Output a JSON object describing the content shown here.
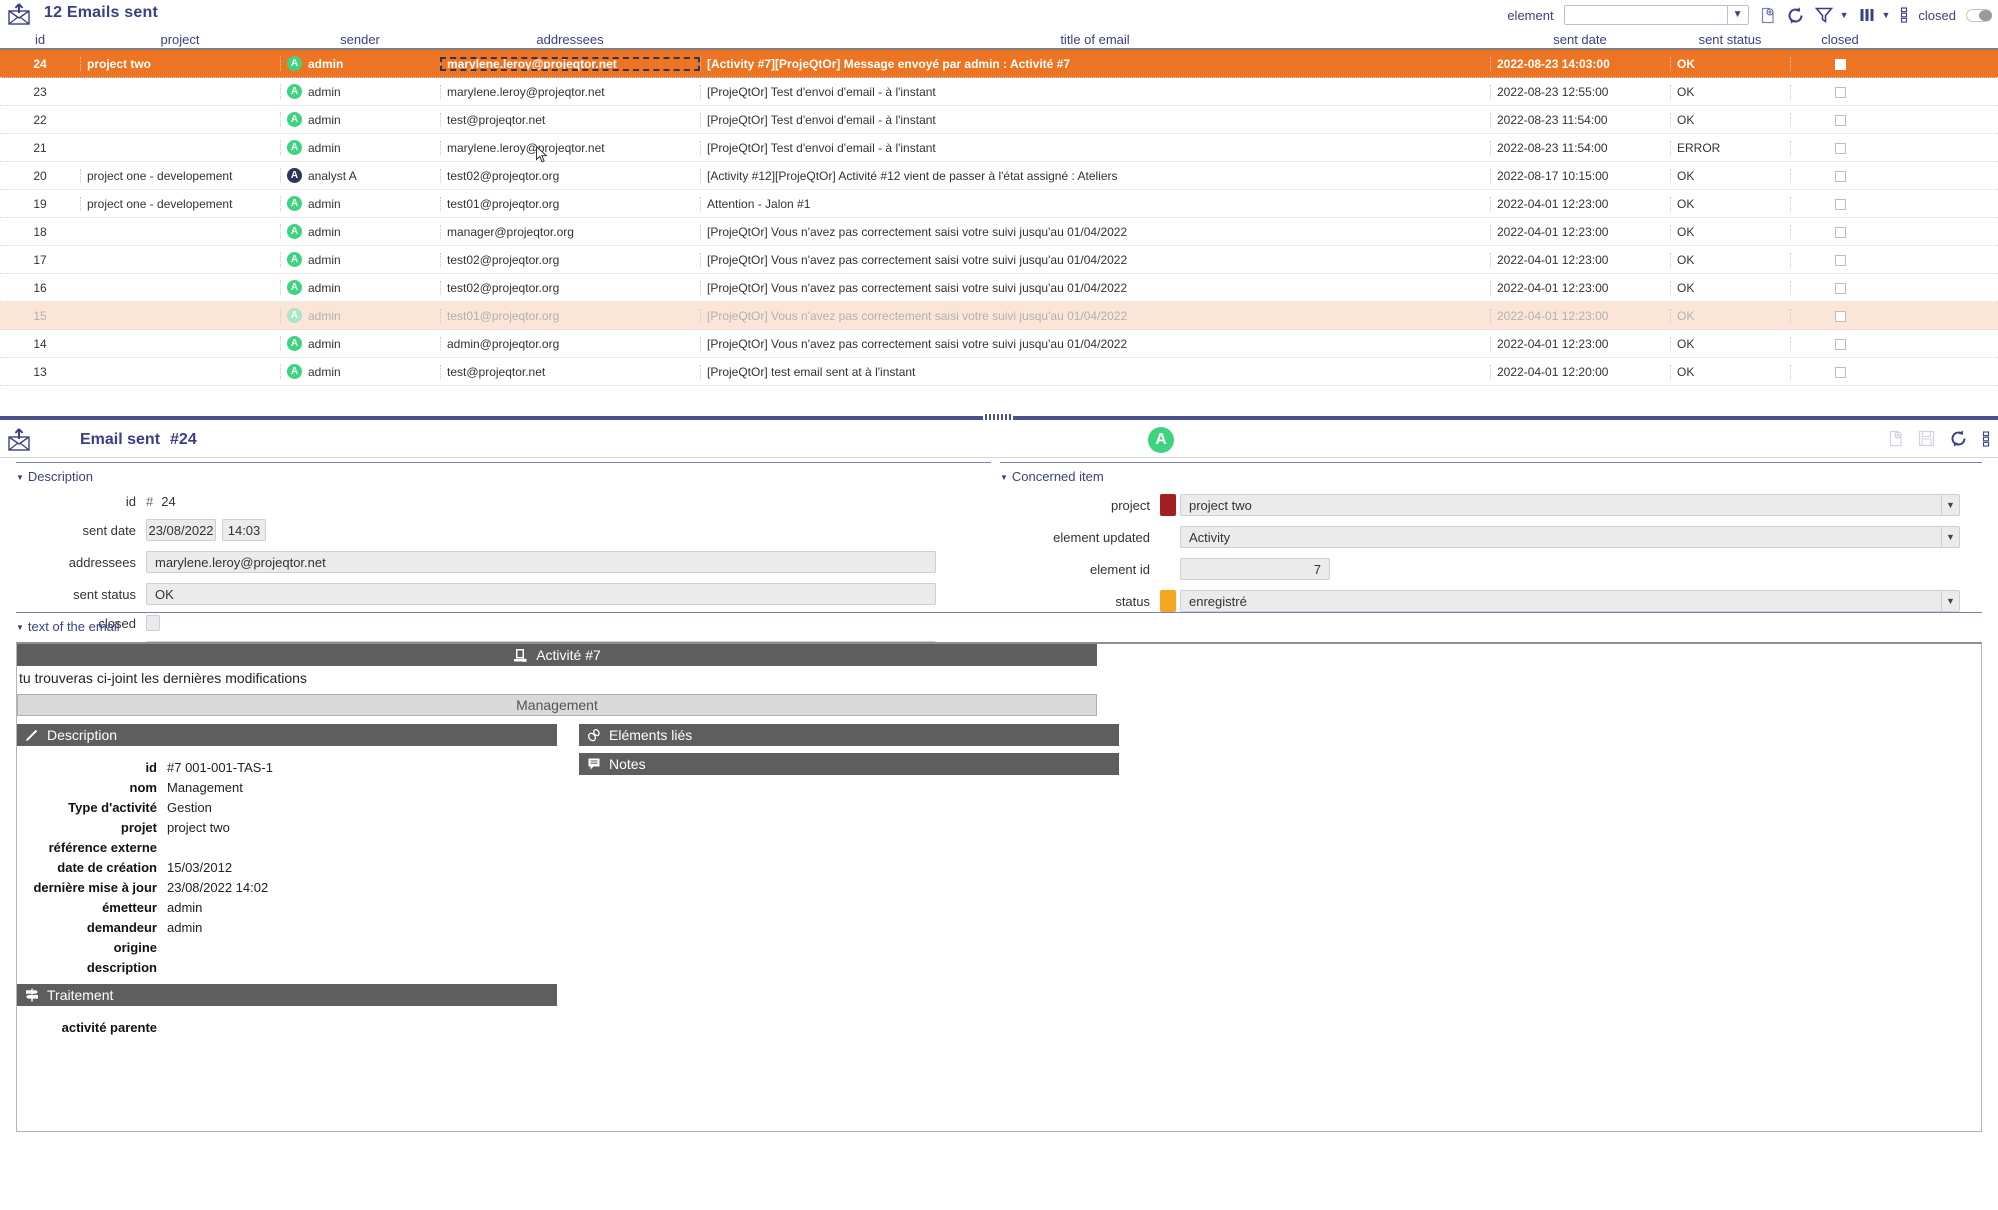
{
  "list": {
    "title": "12 Emails sent",
    "title_icon": "email-sent-icon",
    "toolbar": {
      "element_label": "element",
      "element_value": "",
      "closed_label": "closed",
      "icons": [
        "new-document-icon",
        "refresh-icon",
        "filter-icon",
        "columns-icon",
        "menu-icon"
      ]
    },
    "columns": [
      {
        "key": "id",
        "label": "id"
      },
      {
        "key": "project",
        "label": "project"
      },
      {
        "key": "sender",
        "label": "sender"
      },
      {
        "key": "addressees",
        "label": "addressees"
      },
      {
        "key": "title",
        "label": "title of email"
      },
      {
        "key": "sent_date",
        "label": "sent date"
      },
      {
        "key": "sent_status",
        "label": "sent status"
      },
      {
        "key": "closed",
        "label": "closed"
      }
    ],
    "rows": [
      {
        "id": "24",
        "project": "project two",
        "sender": "admin",
        "avatar": "A",
        "avatar_style": "green",
        "addressees": "marylene.leroy@projeqtor.net",
        "title": "[Activity #7][ProjeQtOr] Message envoyé par admin : Activité #7",
        "sent_date": "2022-08-23 14:03:00",
        "sent_status": "OK",
        "closed": false,
        "state": "selected"
      },
      {
        "id": "23",
        "project": "",
        "sender": "admin",
        "avatar": "A",
        "avatar_style": "green",
        "addressees": "marylene.leroy@projeqtor.net",
        "title": "[ProjeQtOr] Test d'envoi d'email - à l'instant",
        "sent_date": "2022-08-23 12:55:00",
        "sent_status": "OK",
        "closed": false,
        "state": "normal"
      },
      {
        "id": "22",
        "project": "",
        "sender": "admin",
        "avatar": "A",
        "avatar_style": "green",
        "addressees": "test@projeqtor.net",
        "title": "[ProjeQtOr] Test d'envoi d'email - à l'instant",
        "sent_date": "2022-08-23 11:54:00",
        "sent_status": "OK",
        "closed": false,
        "state": "normal"
      },
      {
        "id": "21",
        "project": "",
        "sender": "admin",
        "avatar": "A",
        "avatar_style": "green",
        "addressees": "marylene.leroy@projeqtor.net",
        "title": "[ProjeQtOr] Test d'envoi d'email - à l'instant",
        "sent_date": "2022-08-23 11:54:00",
        "sent_status": "ERROR",
        "closed": false,
        "state": "normal"
      },
      {
        "id": "20",
        "project": "project one - developement",
        "sender": "analyst A",
        "avatar": "A",
        "avatar_style": "dark",
        "addressees": "test02@projeqtor.org",
        "title": "[Activity #12][ProjeQtOr] Activité #12 vient de passer à l'état assigné : Ateliers",
        "sent_date": "2022-08-17 10:15:00",
        "sent_status": "OK",
        "closed": false,
        "state": "normal"
      },
      {
        "id": "19",
        "project": "project one - developement",
        "sender": "admin",
        "avatar": "A",
        "avatar_style": "green",
        "addressees": "test01@projeqtor.org",
        "title": "Attention - Jalon #1",
        "sent_date": "2022-04-01 12:23:00",
        "sent_status": "OK",
        "closed": false,
        "state": "normal"
      },
      {
        "id": "18",
        "project": "",
        "sender": "admin",
        "avatar": "A",
        "avatar_style": "green",
        "addressees": "manager@projeqtor.org",
        "title": "[ProjeQtOr] Vous n'avez pas correctement saisi votre suivi jusqu'au 01/04/2022",
        "sent_date": "2022-04-01 12:23:00",
        "sent_status": "OK",
        "closed": false,
        "state": "normal"
      },
      {
        "id": "17",
        "project": "",
        "sender": "admin",
        "avatar": "A",
        "avatar_style": "green",
        "addressees": "test02@projeqtor.org",
        "title": "[ProjeQtOr] Vous n'avez pas correctement saisi votre suivi jusqu'au 01/04/2022",
        "sent_date": "2022-04-01 12:23:00",
        "sent_status": "OK",
        "closed": false,
        "state": "normal"
      },
      {
        "id": "16",
        "project": "",
        "sender": "admin",
        "avatar": "A",
        "avatar_style": "green",
        "addressees": "test02@projeqtor.org",
        "title": "[ProjeQtOr] Vous n'avez pas correctement saisi votre suivi jusqu'au 01/04/2022",
        "sent_date": "2022-04-01 12:23:00",
        "sent_status": "OK",
        "closed": false,
        "state": "normal"
      },
      {
        "id": "15",
        "project": "",
        "sender": "admin",
        "avatar": "A",
        "avatar_style": "faded",
        "addressees": "test01@projeqtor.org",
        "title": "[ProjeQtOr] Vous n'avez pas correctement saisi votre suivi jusqu'au 01/04/2022",
        "sent_date": "2022-04-01 12:23:00",
        "sent_status": "OK",
        "closed": false,
        "state": "dimmed"
      },
      {
        "id": "14",
        "project": "",
        "sender": "admin",
        "avatar": "A",
        "avatar_style": "green",
        "addressees": "admin@projeqtor.org",
        "title": "[ProjeQtOr] Vous n'avez pas correctement saisi votre suivi jusqu'au 01/04/2022",
        "sent_date": "2022-04-01 12:23:00",
        "sent_status": "OK",
        "closed": false,
        "state": "normal"
      },
      {
        "id": "13",
        "project": "",
        "sender": "admin",
        "avatar": "A",
        "avatar_style": "green",
        "addressees": "test@projeqtor.net",
        "title": "[ProjeQtOr] test email sent at à l'instant",
        "sent_date": "2022-04-01 12:20:00",
        "sent_status": "OK",
        "closed": false,
        "state": "normal"
      }
    ]
  },
  "detail": {
    "title": "Email sent",
    "number": "#24",
    "avatar": "A",
    "tools": [
      "new-document-icon",
      "save-icon",
      "refresh-icon",
      "menu-icon"
    ],
    "description": {
      "section_label": "Description",
      "fields": {
        "id_label": "id",
        "id_hash": "#",
        "id_value": "24",
        "sent_date_label": "sent date",
        "sent_date_value": "23/08/2022",
        "sent_time_value": "14:03",
        "addressees_label": "addressees",
        "addressees_value": "marylene.leroy@projeqtor.net",
        "sent_status_label": "sent status",
        "sent_status_value": "OK",
        "closed_label": "closed",
        "closed_value": false,
        "title_label": "title of email",
        "title_value": "[Activity #7][ProjeQtOr] Message envoyé par admin : Activité #7"
      }
    },
    "concerned_item": {
      "section_label": "Concerned item",
      "fields": {
        "project_label": "project",
        "project_value": "project two",
        "project_color": "#a31f21",
        "element_updated_label": "element updated",
        "element_updated_value": "Activity",
        "element_id_label": "element id",
        "element_id_value": "7",
        "status_label": "status",
        "status_value": "enregistré",
        "status_color": "#f5a623"
      }
    },
    "email_text": {
      "section_label": "text of the email",
      "card_title": "Activité #7",
      "card_title_icon": "activity-icon",
      "paragraph": "tu trouveras ci-joint les dernières modifications",
      "subtitle_bar": "Management",
      "left_panel_title": "Description",
      "left_panel_icon": "pencil-icon",
      "right_panel_title": "Eléments liés",
      "right_panel_icon": "link-icon",
      "notes_panel_title": "Notes",
      "notes_panel_icon": "note-icon",
      "treatment_title": "Traitement",
      "treatment_icon": "signpost-icon",
      "description_rows": [
        {
          "key": "id",
          "value": "#7   001-001-TAS-1"
        },
        {
          "key": "nom",
          "value": "Management"
        },
        {
          "key": "Type d'activité",
          "value": "Gestion"
        },
        {
          "key": "projet",
          "value": "project two"
        },
        {
          "key": "référence externe",
          "value": ""
        },
        {
          "key": "date de création",
          "value": "15/03/2012"
        },
        {
          "key": "dernière mise à jour",
          "value": "23/08/2022 14:02"
        },
        {
          "key": "émetteur",
          "value": "admin"
        },
        {
          "key": "demandeur",
          "value": "admin"
        },
        {
          "key": "origine",
          "value": ""
        },
        {
          "key": "description",
          "value": ""
        }
      ],
      "treatment_rows": [
        {
          "key": "activité parente",
          "value": ""
        }
      ]
    }
  }
}
